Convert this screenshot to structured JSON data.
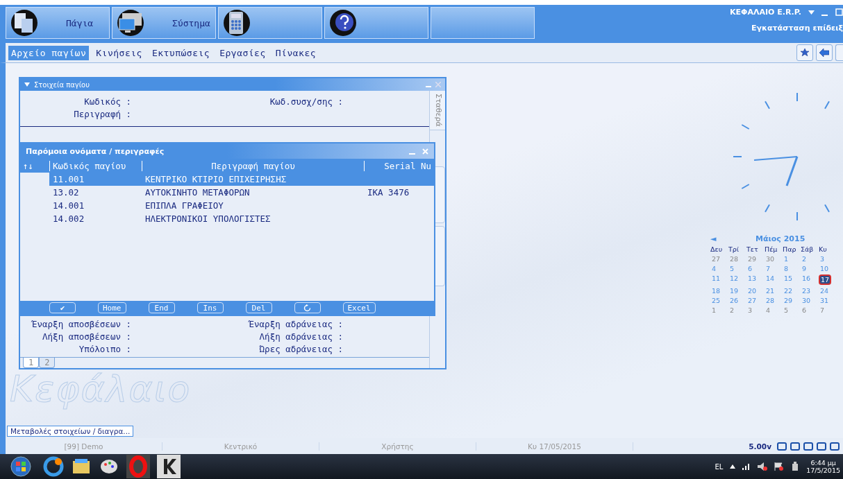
{
  "modules": [
    {
      "kind": "labeled",
      "label": "Πάγια"
    },
    {
      "kind": "labeled",
      "label": "Σύστημα"
    },
    {
      "kind": "icon_only"
    },
    {
      "kind": "icon_only"
    }
  ],
  "app_title": "ΚΕΦΑΛΑΙΟ E.R.P.",
  "app_subtitle": "Εγκατάσταση επίδειξ",
  "menu": [
    {
      "label": "Αρχείο παγίων",
      "selected": true
    },
    {
      "label": "Κινήσεις",
      "selected": false
    },
    {
      "label": "Εκτυπώσεις",
      "selected": false
    },
    {
      "label": "Εργασίες",
      "selected": false
    },
    {
      "label": "Πίνακες",
      "selected": false
    }
  ],
  "asset_window": {
    "title": "Στοιχεία παγίου",
    "side_tab": "Σταθερά",
    "top_fields": [
      [
        "Κωδικός :",
        "Κωδ.συσχ/σης :"
      ],
      [
        "Περιγραφή :"
      ]
    ],
    "bottom_fields": [
      [
        "Έναρξη αποσβέσεων :",
        "Έναρξη αδράνειας :"
      ],
      [
        "Λήξη αποσβέσεων :",
        "Λήξη αδράνειας :"
      ],
      [
        "Υπόλοιπο :",
        "Ώρες αδράνειας :"
      ]
    ],
    "tabs": [
      {
        "label": "1",
        "selected": true
      },
      {
        "label": "2",
        "selected": false
      }
    ]
  },
  "similar_dialog": {
    "title": "Παρόμοια ονόματα / περιγραφές",
    "sort_icon": "↑↓",
    "columns": [
      "Κωδικός παγίου",
      "Περιγραφή παγίου",
      "Serial Nu"
    ],
    "rows": [
      {
        "cells": [
          "11.001",
          "ΚΕΝΤΡΙΚΟ ΚΤΙΡΙΟ ΕΠΙΧΕΙΡΗΣΗΣ",
          ""
        ],
        "selected": true
      },
      {
        "cells": [
          "13.02",
          "ΑΥΤΟΚΙΝΗΤΟ ΜΕΤΑΦΟΡΩΝ",
          "ΙΚΑ 3476"
        ],
        "selected": false
      },
      {
        "cells": [
          "14.001",
          "ΕΠΙΠΛΑ ΓΡΑΦΕΙΟΥ",
          ""
        ],
        "selected": false
      },
      {
        "cells": [
          "14.002",
          "ΗΛΕΚΤΡΟΝΙΚΟΙ ΥΠΟΛΟΓΙΣΤΕΣ",
          ""
        ],
        "selected": false
      }
    ],
    "buttons": [
      {
        "kind": "check",
        "label": "✔"
      },
      {
        "kind": "text",
        "label": "Home"
      },
      {
        "kind": "text",
        "label": "End"
      },
      {
        "kind": "text",
        "label": "Ins"
      },
      {
        "kind": "text",
        "label": "Del"
      },
      {
        "kind": "refresh"
      },
      {
        "kind": "text",
        "label": "Excel"
      }
    ]
  },
  "logo_text": "Κεφάλαιο",
  "calendar": {
    "month": "Μάιος 2015",
    "prev": "◄",
    "weekdays": [
      "Δευ",
      "Τρί",
      "Τετ",
      "Πέμ",
      "Παρ",
      "Σάβ",
      "Κυ"
    ],
    "weeks": [
      [
        {
          "d": "27",
          "other": true
        },
        {
          "d": "28",
          "other": true
        },
        {
          "d": "29",
          "other": true
        },
        {
          "d": "30",
          "other": true
        },
        {
          "d": "1",
          "other": false
        },
        {
          "d": "2",
          "other": false
        },
        {
          "d": "3",
          "other": false
        }
      ],
      [
        {
          "d": "4",
          "other": false
        },
        {
          "d": "5",
          "other": false
        },
        {
          "d": "6",
          "other": false
        },
        {
          "d": "7",
          "other": false
        },
        {
          "d": "8",
          "other": false
        },
        {
          "d": "9",
          "other": false
        },
        {
          "d": "10",
          "other": false
        }
      ],
      [
        {
          "d": "11",
          "other": false
        },
        {
          "d": "12",
          "other": false
        },
        {
          "d": "13",
          "other": false
        },
        {
          "d": "14",
          "other": false
        },
        {
          "d": "15",
          "other": false
        },
        {
          "d": "16",
          "other": false
        },
        {
          "d": "17",
          "other": false,
          "selected": true
        }
      ],
      [
        {
          "d": "18",
          "other": false
        },
        {
          "d": "19",
          "other": false
        },
        {
          "d": "20",
          "other": false
        },
        {
          "d": "21",
          "other": false
        },
        {
          "d": "22",
          "other": false
        },
        {
          "d": "23",
          "other": false
        },
        {
          "d": "24",
          "other": false
        }
      ],
      [
        {
          "d": "25",
          "other": false
        },
        {
          "d": "26",
          "other": false
        },
        {
          "d": "27",
          "other": false
        },
        {
          "d": "28",
          "other": false
        },
        {
          "d": "29",
          "other": false
        },
        {
          "d": "30",
          "other": false
        },
        {
          "d": "31",
          "other": false
        }
      ],
      [
        {
          "d": "1",
          "other": true
        },
        {
          "d": "2",
          "other": true
        },
        {
          "d": "3",
          "other": true
        },
        {
          "d": "4",
          "other": true
        },
        {
          "d": "5",
          "other": true
        },
        {
          "d": "6",
          "other": true
        },
        {
          "d": "7",
          "other": true
        }
      ]
    ]
  },
  "open_tab": "Μεταβολές στοιχείων / διαγρα...",
  "status_bar": {
    "cells": [
      "[99] Demo",
      "Κεντρικό",
      "Χρήστης",
      "Κυ 17/05/2015"
    ],
    "version": "5.00v"
  },
  "taskbar": {
    "language": "EL",
    "time": "6:44 μμ",
    "date": "17/5/2015"
  }
}
